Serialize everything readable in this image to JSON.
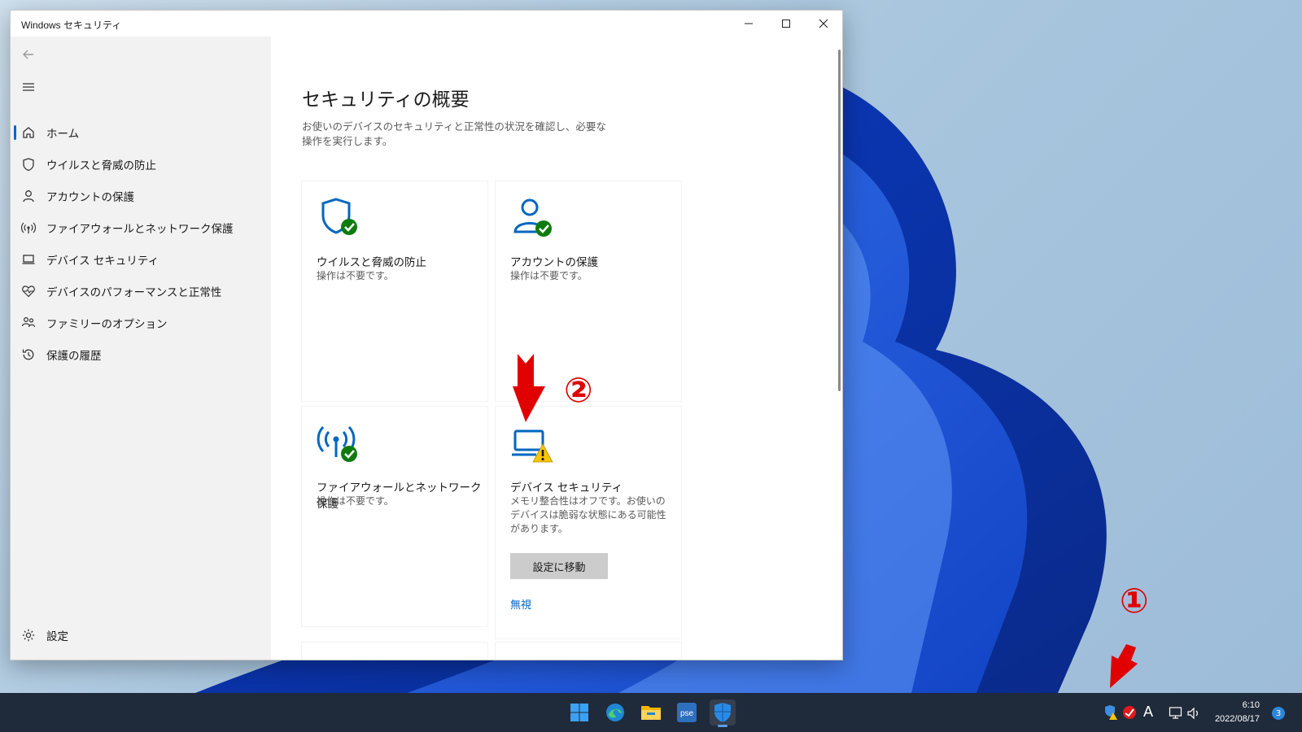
{
  "window": {
    "title": "Windows セキュリティ"
  },
  "sidebar": {
    "items": [
      {
        "label": "ホーム",
        "icon": "home-icon",
        "active": true
      },
      {
        "label": "ウイルスと脅威の防止",
        "icon": "shield-icon"
      },
      {
        "label": "アカウントの保護",
        "icon": "person-icon"
      },
      {
        "label": "ファイアウォールとネットワーク保護",
        "icon": "antenna-icon"
      },
      {
        "label": "デバイス セキュリティ",
        "icon": "laptop-icon"
      },
      {
        "label": "デバイスのパフォーマンスと正常性",
        "icon": "heart-pulse-icon"
      },
      {
        "label": "ファミリーのオプション",
        "icon": "family-icon"
      },
      {
        "label": "保護の履歴",
        "icon": "history-icon"
      }
    ],
    "settings_label": "設定"
  },
  "main": {
    "title": "セキュリティの概要",
    "description": "お使いのデバイスのセキュリティと正常性の状況を確認し、必要な操作を実行します。",
    "cards": [
      {
        "title": "ウイルスと脅威の防止",
        "status": "操作は不要です。",
        "icon": "shield-check-icon"
      },
      {
        "title": "アカウントの保護",
        "status": "操作は不要です。",
        "icon": "person-check-icon"
      },
      {
        "title": "ファイアウォールとネットワーク保護",
        "status": "操作は不要です。",
        "icon": "antenna-check-icon"
      },
      {
        "title": "デバイス セキュリティ",
        "status": "メモリ整合性はオフです。お使いのデバイスは脆弱な状態にある可能性があります。",
        "icon": "laptop-warning-icon",
        "button_label": "設定に移動",
        "link_label": "無視"
      }
    ]
  },
  "annotations": {
    "step1": "①",
    "step2": "②"
  },
  "taskbar": {
    "apps": [
      "start-icon",
      "edge-icon",
      "file-explorer-icon",
      "photoshop-elements-icon",
      "windows-security-icon"
    ],
    "ime": "A",
    "time": "6:10",
    "date": "2022/08/17",
    "notification_count": "3"
  },
  "colors": {
    "accent": "#0067c0",
    "success": "#0f7b0f",
    "warning": "#f7c600",
    "annotation": "#e00000"
  }
}
